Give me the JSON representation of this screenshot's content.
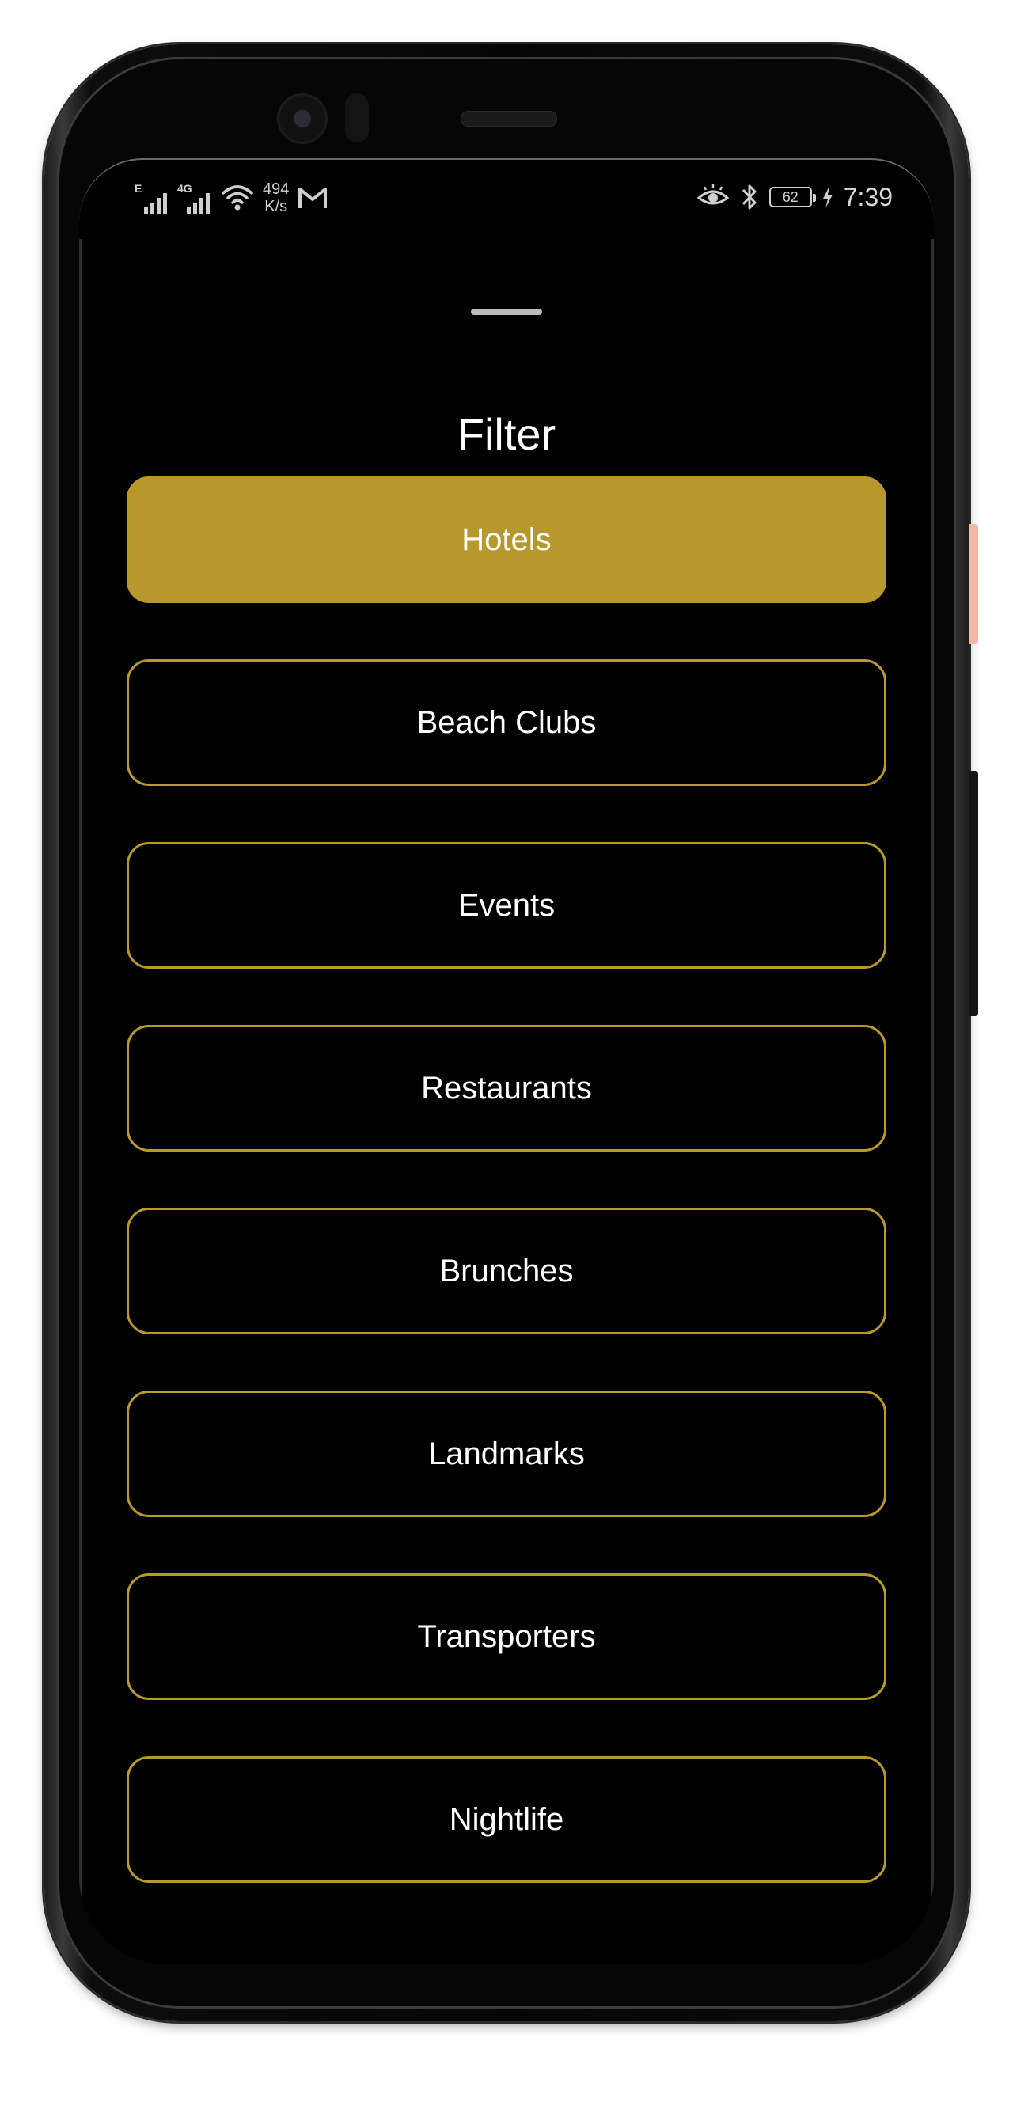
{
  "status_bar": {
    "network_type_1": "E",
    "network_type_2": "4G",
    "speed_value": "494",
    "speed_unit": "K/s",
    "battery_level": "62",
    "time": "7:39"
  },
  "sheet": {
    "title": "Filter",
    "filters": [
      {
        "label": "Hotels",
        "selected": true
      },
      {
        "label": "Beach Clubs",
        "selected": false
      },
      {
        "label": "Events",
        "selected": false
      },
      {
        "label": "Restaurants",
        "selected": false
      },
      {
        "label": "Brunches",
        "selected": false
      },
      {
        "label": "Landmarks",
        "selected": false
      },
      {
        "label": "Transporters",
        "selected": false
      },
      {
        "label": "Nightlife",
        "selected": false
      }
    ]
  },
  "colors": {
    "accent": "#b7982c",
    "background": "#000000",
    "text": "#ffffff"
  }
}
